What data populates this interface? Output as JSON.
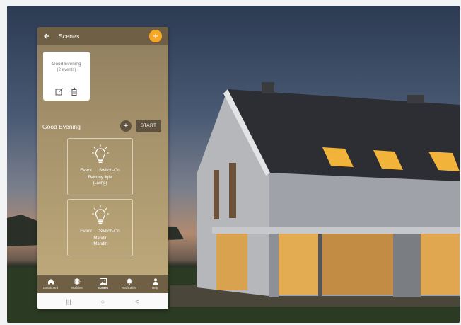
{
  "app": {
    "title": "Scenes",
    "back_icon": "arrow-left-icon",
    "add_icon": "plus-icon",
    "accent": "#f5a623",
    "bar_color": "#6e5f45"
  },
  "scene_card": {
    "name": "Good Evening",
    "count": "(2 events)",
    "edit_icon": "edit-icon",
    "delete_icon": "trash-icon"
  },
  "section": {
    "title": "Good Evening",
    "add_icon": "plus-icon",
    "start_label": "START"
  },
  "events": [
    {
      "type": "Event",
      "action": "Switch-On",
      "device": "Balcony light",
      "room": "(Living)",
      "icon": "bulb-icon"
    },
    {
      "type": "Event",
      "action": "Switch-On",
      "device": "Mandir",
      "room": "(Mandir)",
      "icon": "bulb-icon"
    }
  ],
  "bottom_nav": [
    {
      "label": "Dashboard",
      "icon": "home-icon"
    },
    {
      "label": "Modules",
      "icon": "layers-icon"
    },
    {
      "label": "Scenes",
      "icon": "image-icon",
      "active": true
    },
    {
      "label": "Notification",
      "icon": "bell-icon"
    },
    {
      "label": "Help",
      "icon": "person-icon"
    }
  ],
  "system_nav": {
    "recents": "|||",
    "home": "○",
    "back": "<"
  }
}
